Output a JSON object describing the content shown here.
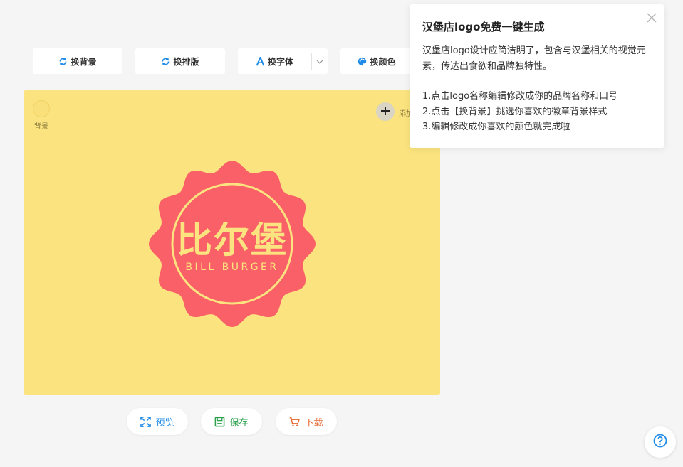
{
  "toolbar": {
    "change_background": "换背景",
    "change_layout": "换排版",
    "change_font": "换字体",
    "change_color": "换颜色"
  },
  "canvas": {
    "background_label": "背景",
    "add_label": "添加",
    "logo": {
      "name_text": "比尔堡",
      "slogan_text": "BILL BURGER"
    }
  },
  "actions": {
    "preview": "预览",
    "save": "保存",
    "download": "下载"
  },
  "popup": {
    "title": "汉堡店logo免费一键生成",
    "description": "汉堡店logo设计应简洁明了，包含与汉堡相关的视觉元素，传达出食欲和品牌独特性。",
    "steps": [
      "1.点击logo名称编辑修改成你的品牌名称和口号",
      "2.点击【换背景】挑选你喜欢的徽章背景样式",
      "3.编辑修改成你喜欢的颜色就完成啦"
    ]
  },
  "colors": {
    "canvas_bg": "#fbe47f",
    "badge": "#fa6068",
    "badge_text": "#fbe47f",
    "accent_blue": "#1e8be6",
    "accent_green": "#2aa04a",
    "accent_orange": "#e8642c"
  }
}
